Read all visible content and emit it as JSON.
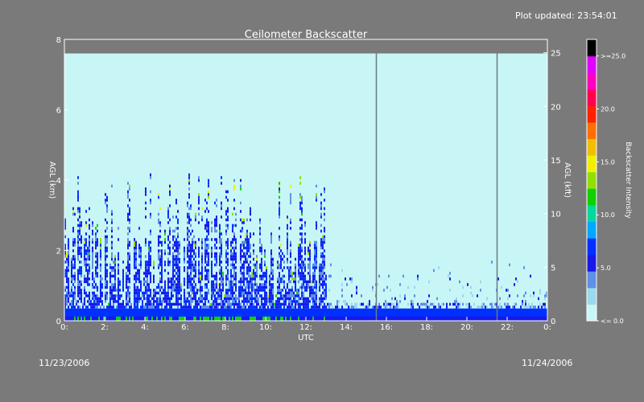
{
  "header": {
    "updated": "Plot updated: 23:54:01"
  },
  "footer": {
    "date_left": "11/23/2006",
    "date_right": "11/24/2006"
  },
  "chart_data": {
    "type": "heatmap",
    "title": "Ceilometer Backscatter",
    "xlabel": "UTC",
    "ylabel": "AGL (km)",
    "y2label": "AGL (kft)",
    "colorbar_label": "Backscatter Intensity",
    "xlim": [
      0,
      24
    ],
    "ylim": [
      0,
      8
    ],
    "y2lim": [
      0,
      26.25
    ],
    "x_ticks": [
      "0:",
      "2:",
      "4:",
      "6:",
      "8:",
      "10:",
      "12:",
      "14:",
      "16:",
      "18:",
      "20:",
      "22:",
      "0:"
    ],
    "y_ticks": [
      "0",
      "2",
      "4",
      "6",
      "8"
    ],
    "y2_ticks": [
      "0",
      "5",
      "10",
      "15",
      "20",
      "25"
    ],
    "colorbar_ticks": [
      "<= 0.0",
      "5.0",
      "10.0",
      "15.0",
      "20.0",
      ">=25.0"
    ],
    "colorbar_range": [
      0,
      25
    ],
    "data_top_km": 7.6,
    "vertical_lines_utc": [
      15.5,
      21.5
    ],
    "segments": [
      {
        "from_utc": 0,
        "to_utc": 13,
        "cloud_top_km": 3.2,
        "dense_top_km": 2.3,
        "description_level": "strong"
      },
      {
        "from_utc": 13,
        "to_utc": 24,
        "cloud_top_km": 1.5,
        "dense_top_km": 0.5,
        "description_level": "weak"
      }
    ],
    "colors": {
      "background": "#7a7a7a",
      "no_signal": "#c8f6f6",
      "colormap": [
        "#c8f6f6",
        "#9ad8ee",
        "#5f8fe6",
        "#1818e8",
        "#0030ff",
        "#00a8ff",
        "#00d8a0",
        "#10d000",
        "#90e000",
        "#f0f000",
        "#f0c000",
        "#ff7000",
        "#ff2000",
        "#ff0050",
        "#ff00c0",
        "#e000ff",
        "#000000"
      ]
    }
  }
}
